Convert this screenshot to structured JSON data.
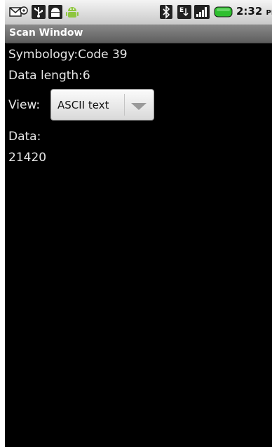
{
  "status_bar": {
    "time": "2:32",
    "ampm": "PM",
    "icons": [
      "missed-notification-icon",
      "usb-icon",
      "android-debug-icon",
      "android-robot-icon",
      "bluetooth-icon",
      "edge-data-icon",
      "signal-bars-icon",
      "battery-icon"
    ],
    "battery_color": "#2fbf2f"
  },
  "title_bar": {
    "title": "Scan Window"
  },
  "content": {
    "symbology": "Symbology:Code 39",
    "data_length": "Data length:6",
    "view_label": "View:",
    "view_select": {
      "selected": "ASCII text"
    },
    "data_label": "Data:",
    "data_value": "21420"
  },
  "colors": {
    "background": "#000000",
    "text": "#e6e6e6",
    "title_bar": "#6e6e6e"
  }
}
